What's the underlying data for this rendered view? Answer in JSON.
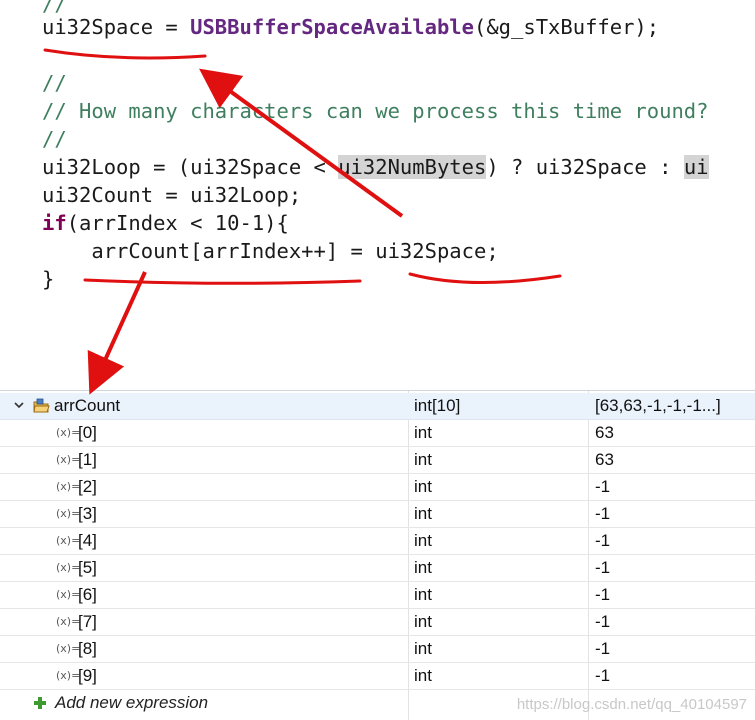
{
  "code": {
    "lines": [
      {
        "id": "l0",
        "text": "//"
      },
      {
        "id": "l1a",
        "text": "ui32Space = "
      },
      {
        "id": "l1b",
        "text": "USBBufferSpaceAvailable"
      },
      {
        "id": "l1c",
        "text": "(&g_sTxBuffer);"
      },
      {
        "id": "l2",
        "text": "//"
      },
      {
        "id": "l3",
        "text": "// How many characters can we process this time round?"
      },
      {
        "id": "l4",
        "text": "//"
      },
      {
        "id": "l5a",
        "text": "ui32Loop = (ui32Space < "
      },
      {
        "id": "l5b",
        "text": "ui32NumBytes"
      },
      {
        "id": "l5c",
        "text": ") ? ui32Space : "
      },
      {
        "id": "l5d",
        "text": "ui"
      },
      {
        "id": "l6",
        "text": "ui32Count = ui32Loop;"
      },
      {
        "id": "l7a",
        "text": "if"
      },
      {
        "id": "l7b",
        "text": "(arrIndex < 10-1){"
      },
      {
        "id": "l8",
        "text": "    arrCount[arrIndex++] = ui32Space;"
      },
      {
        "id": "l9",
        "text": "}"
      }
    ]
  },
  "expressions": {
    "root": {
      "name": "arrCount",
      "type": "int[10]",
      "value": "[63,63,-1,-1,-1...]"
    },
    "children": [
      {
        "name": "[0]",
        "type": "int",
        "value": "63"
      },
      {
        "name": "[1]",
        "type": "int",
        "value": "63"
      },
      {
        "name": "[2]",
        "type": "int",
        "value": "-1"
      },
      {
        "name": "[3]",
        "type": "int",
        "value": "-1"
      },
      {
        "name": "[4]",
        "type": "int",
        "value": "-1"
      },
      {
        "name": "[5]",
        "type": "int",
        "value": "-1"
      },
      {
        "name": "[6]",
        "type": "int",
        "value": "-1"
      },
      {
        "name": "[7]",
        "type": "int",
        "value": "-1"
      },
      {
        "name": "[8]",
        "type": "int",
        "value": "-1"
      },
      {
        "name": "[9]",
        "type": "int",
        "value": "-1"
      }
    ],
    "add_label": "Add new expression",
    "var_icon_text": "(x)="
  },
  "watermark": "https://blog.csdn.net/qq_40104597",
  "colors": {
    "comment": "#3f7f5f",
    "function": "#642880",
    "keyword": "#7f0055",
    "annotation": "#e01010"
  },
  "icons": {
    "expand": "chevron-down-icon",
    "struct": "struct-icon",
    "variable": "variable-icon",
    "add": "plus-icon"
  }
}
